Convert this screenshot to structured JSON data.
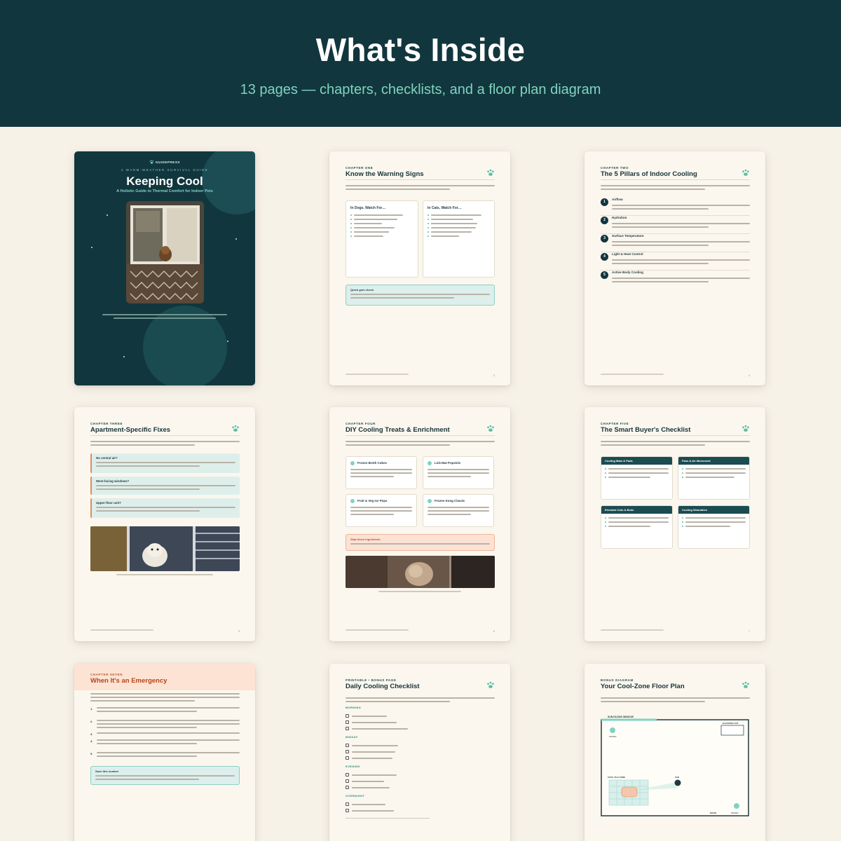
{
  "header": {
    "title": "What's Inside",
    "subtitle": "13 pages — chapters, checklists, and a floor plan diagram"
  },
  "colors": {
    "header_bg": "#12363d",
    "accent_teal": "#7fd3c1",
    "page_bg": "#f7f2e8",
    "emergency_accent": "#b6451c"
  },
  "cover": {
    "brand": "GUIDEPRESS",
    "kicker": "A WARM-WEATHER SURVIVAL GUIDE",
    "title": "Keeping Cool",
    "subtitle": "A Holistic Guide to Thermal Comfort for Indoor Pets"
  },
  "pages": {
    "p3": {
      "eyebrow": "CHAPTER ONE",
      "title": "Know the Warning Signs",
      "dogs_heading": "In Dogs, Watch For…",
      "cats_heading": "In Cats, Watch For…",
      "tip_label": "Quick gum check",
      "page_no": "3"
    },
    "p4": {
      "eyebrow": "CHAPTER TWO",
      "title": "The 5 Pillars of Indoor Cooling",
      "pillars": [
        {
          "n": "1",
          "name": "Airflow"
        },
        {
          "n": "2",
          "name": "Hydration"
        },
        {
          "n": "3",
          "name": "Surface Temperature"
        },
        {
          "n": "4",
          "name": "Light & Heat Control"
        },
        {
          "n": "5",
          "name": "Active Body Cooling"
        }
      ],
      "page_no": "4"
    },
    "p5": {
      "eyebrow": "CHAPTER THREE",
      "title": "Apartment-Specific Fixes",
      "notes": [
        "No central air?",
        "West-facing windows?",
        "Upper-floor unit?"
      ],
      "page_no": "5"
    },
    "p6": {
      "eyebrow": "CHAPTER FOUR",
      "title": "DIY Cooling Treats & Enrichment",
      "treats": [
        "Frozen Broth Cubes",
        "Lick-Mat Popsicle",
        "Fruit & Veg Ice Pops",
        "Frozen Kong Classic"
      ],
      "warning_label": "Skip these ingredients",
      "page_no": "6"
    },
    "p7": {
      "eyebrow": "CHAPTER FIVE",
      "title": "The Smart Buyer's Checklist",
      "categories": [
        "Cooling Mats & Pads",
        "Fans & Air Movement",
        "Elevated Cots & Beds",
        "Cooling Wearables"
      ],
      "page_no": "7"
    },
    "p8": {
      "eyebrow": "CHAPTER SEVEN",
      "title": "When It's an Emergency",
      "steps": [
        "1.",
        "2.",
        "3.",
        "4.",
        "5."
      ],
      "tip_label": "Save this number"
    },
    "p9": {
      "eyebrow": "PRINTABLE • BONUS PAGE",
      "title": "Daily Cooling Checklist",
      "sections": [
        "MORNING",
        "MIDDAY",
        "EVENING",
        "OVERNIGHT"
      ]
    },
    "p10": {
      "eyebrow": "BONUS DIAGRAM",
      "title": "Your Cool-Zone Floor Plan",
      "plan_labels": {
        "window": "SUN-FACING WINDOW",
        "water1": "WATER",
        "cot": "ELEVATED COT",
        "zone": "COOL TILE ZONE",
        "fan": "FAN",
        "door": "DOOR",
        "water2": "WATER"
      }
    }
  }
}
